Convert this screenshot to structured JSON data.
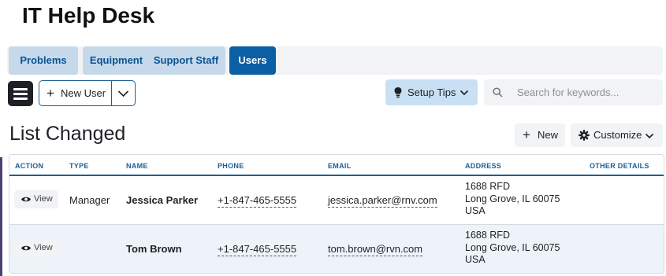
{
  "app": {
    "title": "IT Help Desk"
  },
  "tabs": [
    {
      "label": "Problems",
      "active": false
    },
    {
      "label": "Equipment",
      "active": false
    },
    {
      "label": "Support Staff",
      "active": false
    },
    {
      "label": "Users",
      "active": true
    }
  ],
  "toolbar": {
    "new_user_label": "New User",
    "setup_tips_label": "Setup Tips",
    "search_placeholder": "Search for keywords...",
    "search_value": ""
  },
  "list": {
    "title": "List Changed",
    "new_label": "New",
    "customize_label": "Customize",
    "columns": [
      "ACTION",
      "TYPE",
      "NAME",
      "PHONE",
      "EMAIL",
      "ADDRESS",
      "OTHER DETAILS"
    ],
    "rows": [
      {
        "action": "View",
        "type": "Manager",
        "name": "Jessica Parker",
        "phone": "+1-847-465-5555",
        "email": "jessica.parker@rnv.com",
        "address": [
          "1688 RFD",
          "Long Grove, IL 60075",
          "USA"
        ],
        "other_details": ""
      },
      {
        "action": "View",
        "type": "",
        "name": "Tom Brown",
        "phone": "+1-847-465-5555",
        "email": "tom.brown@rvn.com",
        "address": [
          "1688 RFD",
          "Long Grove, IL 60075",
          "USA"
        ],
        "other_details": ""
      }
    ]
  },
  "colors": {
    "accent": "#0b5fa5",
    "tab_bg": "#c5d9ea",
    "header_text": "#1b5e94",
    "setup_bg": "#c9e0f4"
  },
  "icons": [
    "menu-icon",
    "plus-icon",
    "chevron-down-icon",
    "lightbulb-icon",
    "search-icon",
    "gear-icon",
    "eye-icon"
  ]
}
